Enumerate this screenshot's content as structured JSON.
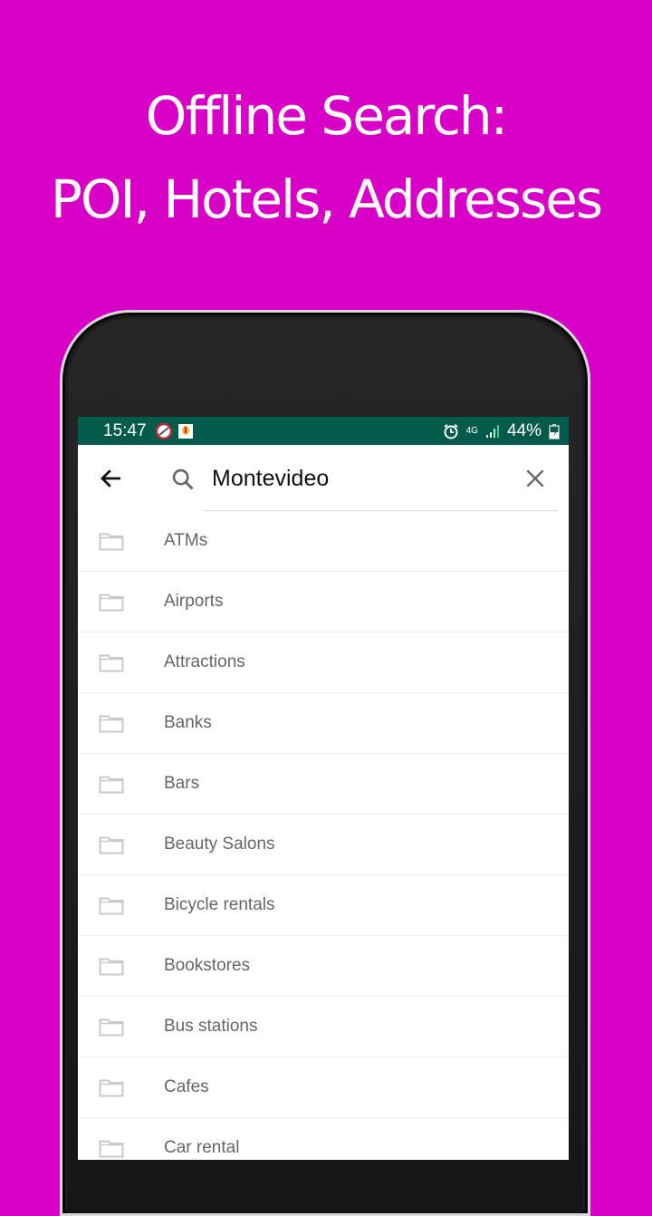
{
  "promo": {
    "line1": "Offline Search:",
    "line2": "POI, Hotels, Addresses",
    "background_color": "#d800c6"
  },
  "status_bar": {
    "time": "15:47",
    "network": "4G",
    "battery": "44%",
    "color": "#035c4b"
  },
  "search": {
    "query": "Montevideo",
    "back_icon": "arrow-left-icon",
    "search_icon": "search-icon",
    "clear_icon": "close-icon"
  },
  "categories": [
    {
      "label": "ATMs",
      "icon": "folder-icon"
    },
    {
      "label": "Airports",
      "icon": "folder-icon"
    },
    {
      "label": "Attractions",
      "icon": "folder-icon"
    },
    {
      "label": "Banks",
      "icon": "folder-icon"
    },
    {
      "label": "Bars",
      "icon": "folder-icon"
    },
    {
      "label": "Beauty Salons",
      "icon": "folder-icon"
    },
    {
      "label": "Bicycle rentals",
      "icon": "folder-icon"
    },
    {
      "label": "Bookstores",
      "icon": "folder-icon"
    },
    {
      "label": "Bus stations",
      "icon": "folder-icon"
    },
    {
      "label": "Cafes",
      "icon": "folder-icon"
    },
    {
      "label": "Car rental",
      "icon": "folder-icon"
    }
  ]
}
